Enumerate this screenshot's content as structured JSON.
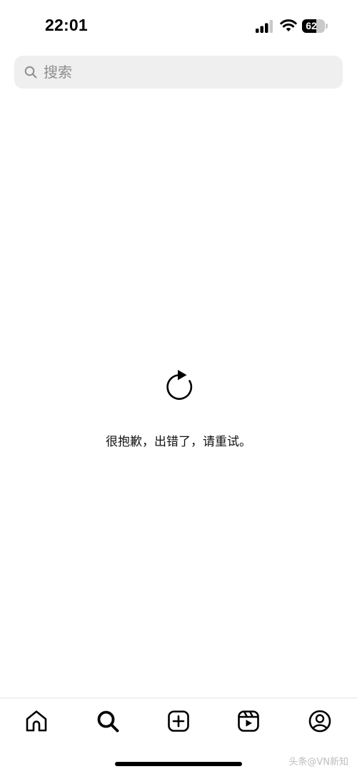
{
  "status_bar": {
    "time": "22:01",
    "battery_level": "62",
    "battery_fraction": 0.62,
    "icons": [
      "signal-icon",
      "wifi-icon",
      "battery-icon"
    ]
  },
  "search": {
    "placeholder": "搜索",
    "value": "",
    "icon": "search-icon"
  },
  "error": {
    "icon": "refresh-icon",
    "message": "很抱歉，出错了，请重试。"
  },
  "bottom_nav": {
    "items": [
      {
        "name": "home",
        "icon": "home-icon"
      },
      {
        "name": "search",
        "icon": "search-icon",
        "active": true
      },
      {
        "name": "create",
        "icon": "plus-square-icon"
      },
      {
        "name": "reels",
        "icon": "reels-icon"
      },
      {
        "name": "profile",
        "icon": "profile-icon"
      }
    ]
  },
  "watermark": "头条@VN新知"
}
